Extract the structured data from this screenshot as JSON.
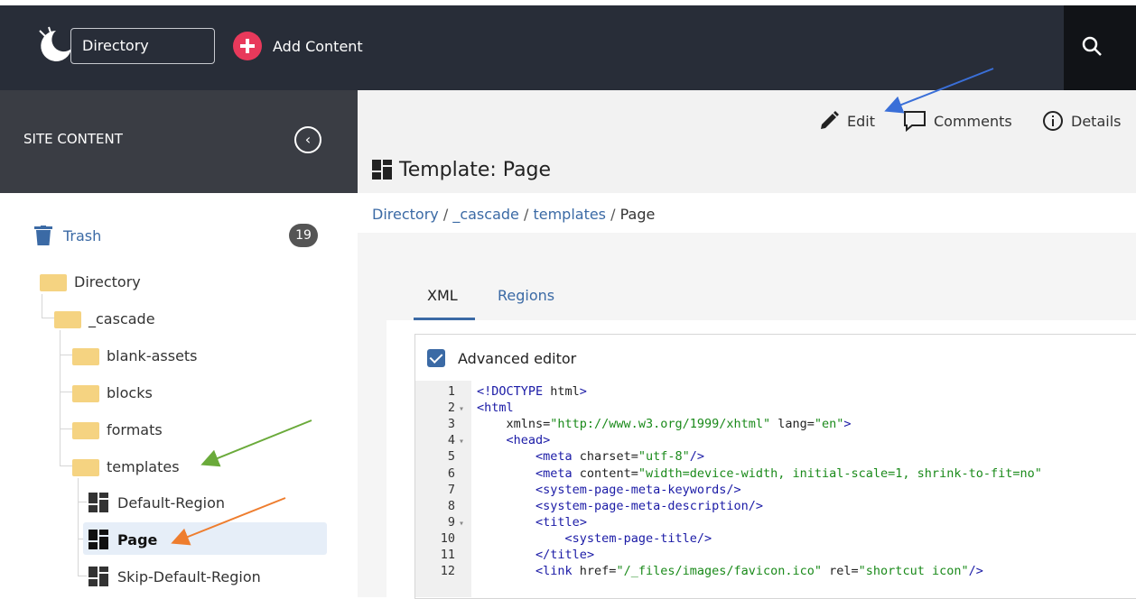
{
  "topbar": {
    "site_select_value": "Directory",
    "add_content_label": "Add Content",
    "colors": {
      "bar": "#282d38",
      "add_button": "#e8395b"
    }
  },
  "sidebar": {
    "title": "SITE CONTENT",
    "trash": {
      "label": "Trash",
      "count": "19"
    },
    "tree": [
      {
        "label": "Directory",
        "type": "folder"
      },
      {
        "label": "_cascade",
        "type": "folder"
      },
      {
        "label": "blank-assets",
        "type": "folder"
      },
      {
        "label": "blocks",
        "type": "folder"
      },
      {
        "label": "formats",
        "type": "folder"
      },
      {
        "label": "templates",
        "type": "folder"
      },
      {
        "label": "Default-Region",
        "type": "template"
      },
      {
        "label": "Page",
        "type": "template",
        "selected": true
      },
      {
        "label": "Skip-Default-Region",
        "type": "template"
      }
    ]
  },
  "toolbar": {
    "edit_label": "Edit",
    "comments_label": "Comments",
    "details_label": "Details"
  },
  "page": {
    "title": "Template: Page",
    "breadcrumb": [
      "Directory",
      "_cascade",
      "templates",
      "Page"
    ]
  },
  "tabs": [
    {
      "label": "XML",
      "active": true
    },
    {
      "label": "Regions",
      "active": false
    }
  ],
  "editor": {
    "advanced_label": "Advanced editor",
    "advanced_checked": true,
    "lines": [
      {
        "n": "1",
        "text": "<!DOCTYPE html>"
      },
      {
        "n": "2",
        "text": "<html"
      },
      {
        "n": "3",
        "text": "    xmlns=\"http://www.w3.org/1999/xhtml\" lang=\"en\">"
      },
      {
        "n": "4",
        "text": "    <head>"
      },
      {
        "n": "5",
        "text": "        <meta charset=\"utf-8\"/>"
      },
      {
        "n": "6",
        "text": "        <meta content=\"width=device-width, initial-scale=1, shrink-to-fit=no\""
      },
      {
        "n": "7",
        "text": "        <system-page-meta-keywords/>"
      },
      {
        "n": "8",
        "text": "        <system-page-meta-description/>"
      },
      {
        "n": "9",
        "text": "        <title>"
      },
      {
        "n": "10",
        "text": "            <system-page-title/>"
      },
      {
        "n": "11",
        "text": "        </title>"
      },
      {
        "n": "12",
        "text": "        <link href=\"/_files/images/favicon.ico\" rel=\"shortcut icon\"/>"
      }
    ]
  },
  "annotation_colors": {
    "blue": "#3a6fd8",
    "green": "#6aaa3a",
    "orange": "#ee7d2e"
  }
}
